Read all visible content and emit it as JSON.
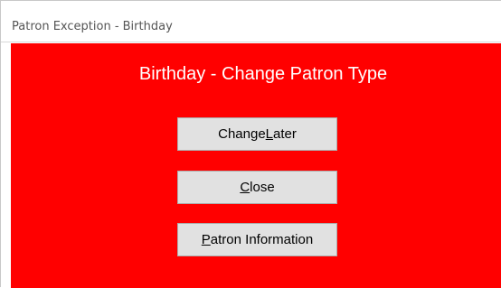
{
  "window": {
    "title": "Patron Exception - Birthday"
  },
  "dialog": {
    "heading": "Birthday - Change Patron Type",
    "buttons": {
      "change_later": {
        "before": "Change ",
        "mnemonic": "L",
        "after": "ater"
      },
      "close": {
        "before": "",
        "mnemonic": "C",
        "after": "lose"
      },
      "patron_information": {
        "before": "",
        "mnemonic": "P",
        "after": "atron Information"
      }
    }
  },
  "colors": {
    "background": "#ff0000",
    "heading_text": "#ffffff",
    "button_face": "#e1e1e1"
  }
}
